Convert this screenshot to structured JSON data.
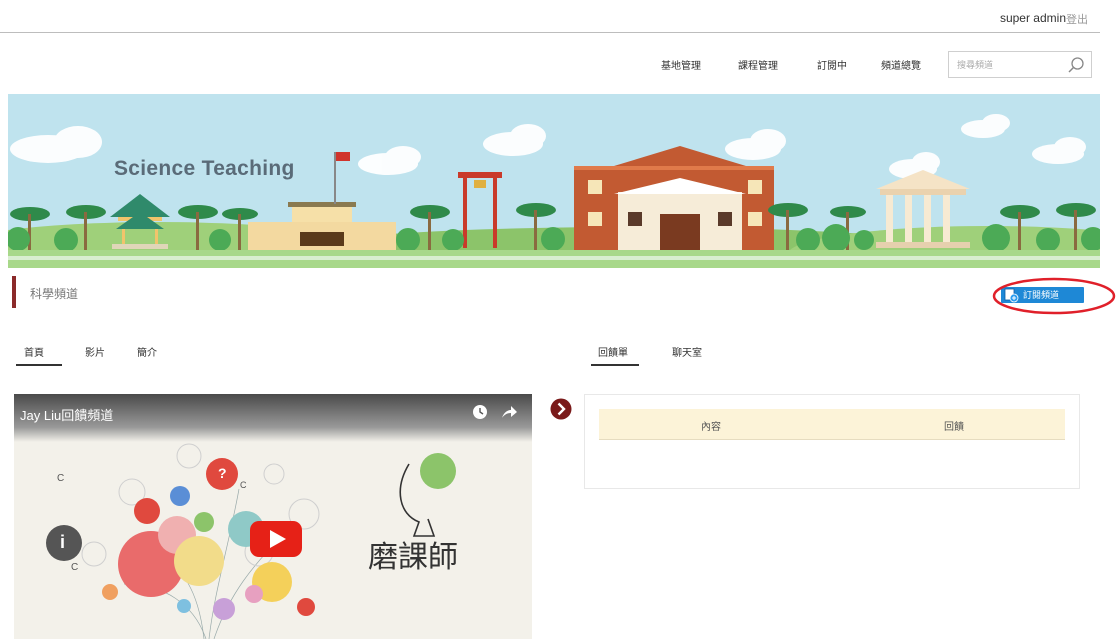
{
  "header": {
    "user_name": "super admin",
    "logout": "登出"
  },
  "nav": {
    "items": [
      "基地管理",
      "課程管理",
      "訂閱中",
      "頻道總覽"
    ],
    "search_placeholder": "搜尋頻道"
  },
  "banner": {
    "title": "Science Teaching"
  },
  "channel": {
    "title": "科學頻道",
    "subscribe_label": "訂閱頻道"
  },
  "left_tabs": [
    "首頁",
    "影片",
    "簡介"
  ],
  "right_tabs": [
    "回饋單",
    "聊天室"
  ],
  "video": {
    "title": "Jay Liu回饋頻道",
    "overlay_texts": [
      "C",
      "C",
      "C",
      "?",
      "i"
    ],
    "logo_caption": "磨課師"
  },
  "leaderboard": {
    "columns": [
      "內容",
      "回饋"
    ]
  },
  "colors": {
    "accent_dark_red": "#8b2a2a",
    "subscribe_blue": "#1e88d6",
    "highlight_red": "#e0202a",
    "table_header_bg": "#fcf3d8",
    "banner_sky": "#bfe3ee"
  }
}
